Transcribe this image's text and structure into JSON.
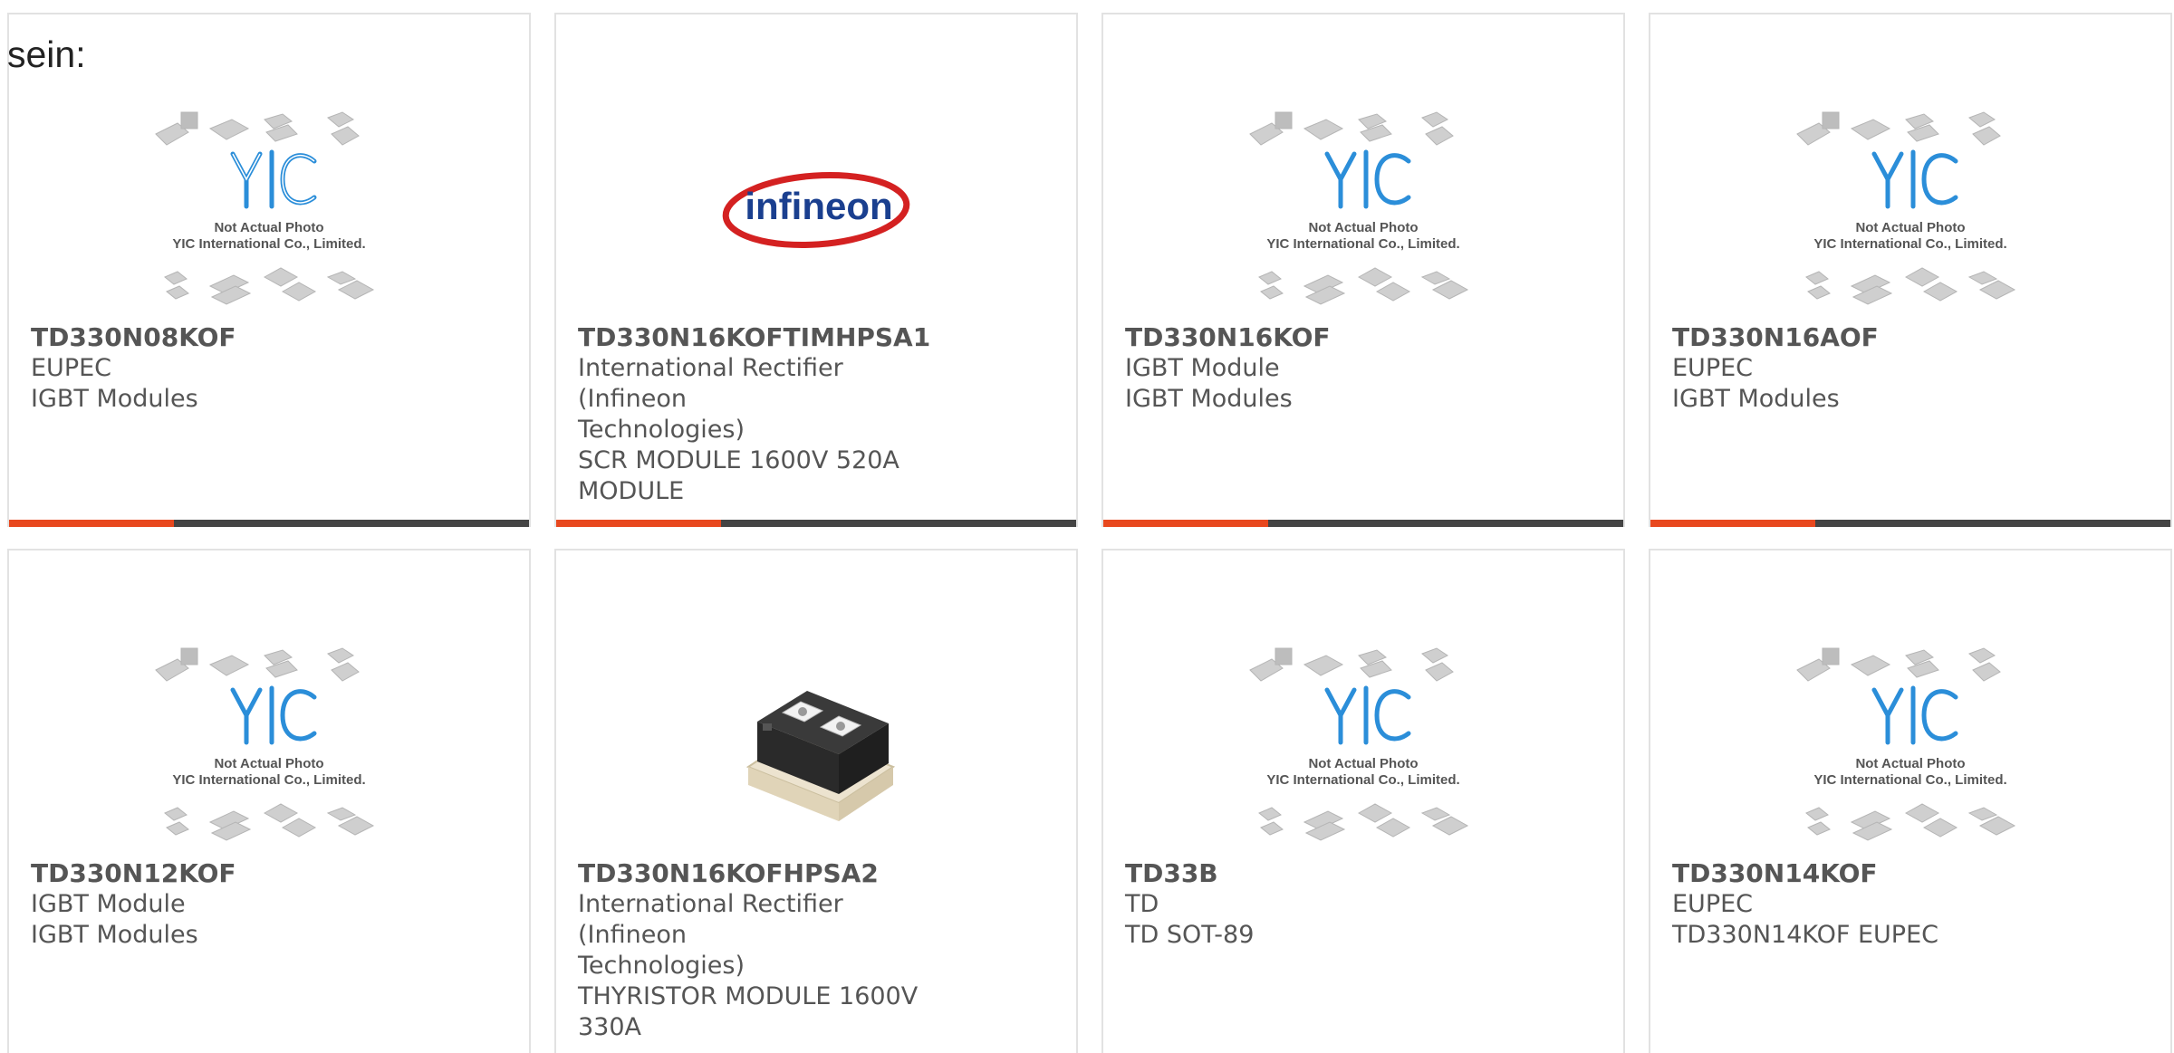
{
  "heading": "sein:",
  "colors": {
    "accent": "#e8481e",
    "bar": "#444444",
    "border": "#e2e2e2",
    "text": "#555555",
    "yic_blue": "#2b8ed9",
    "infineon_blue": "#1a3f8f",
    "infineon_red": "#d42121"
  },
  "placeholder": {
    "line1": "Not Actual Photo",
    "line2": "YIC International Co., Limited."
  },
  "infineon_logo_text": "infineon",
  "products": [
    {
      "part": "TD330N08KOF",
      "line1": "EUPEC",
      "line2": "IGBT Modules",
      "line3": "",
      "line4": "",
      "image": "yic-placeholder",
      "bar": true
    },
    {
      "part": "TD330N16KOFTIMHPSA1",
      "line1": "International Rectifier (Infineon",
      "line2": "Technologies)",
      "line3": "SCR MODULE 1600V 520A",
      "line4": "MODULE",
      "image": "infineon-logo",
      "bar": true
    },
    {
      "part": "TD330N16KOF",
      "line1": "IGBT Module",
      "line2": "IGBT Modules",
      "line3": "",
      "line4": "",
      "image": "yic-placeholder",
      "bar": true
    },
    {
      "part": "TD330N16AOF",
      "line1": "EUPEC",
      "line2": "IGBT Modules",
      "line3": "",
      "line4": "",
      "image": "yic-placeholder",
      "bar": true
    },
    {
      "part": "TD330N12KOF",
      "line1": "IGBT Module",
      "line2": "IGBT Modules",
      "line3": "",
      "line4": "",
      "image": "yic-placeholder",
      "bar": false
    },
    {
      "part": "TD330N16KOFHPSA2",
      "line1": "International Rectifier (Infineon",
      "line2": "Technologies)",
      "line3": "THYRISTOR MODULE 1600V",
      "line4": "330A",
      "image": "thyristor-module-photo",
      "bar": false
    },
    {
      "part": "TD33B",
      "line1": "TD",
      "line2": "TD SOT-89",
      "line3": "",
      "line4": "",
      "image": "yic-placeholder",
      "bar": false
    },
    {
      "part": "TD330N14KOF",
      "line1": "EUPEC",
      "line2": "TD330N14KOF EUPEC",
      "line3": "",
      "line4": "",
      "image": "yic-placeholder",
      "bar": false
    }
  ]
}
